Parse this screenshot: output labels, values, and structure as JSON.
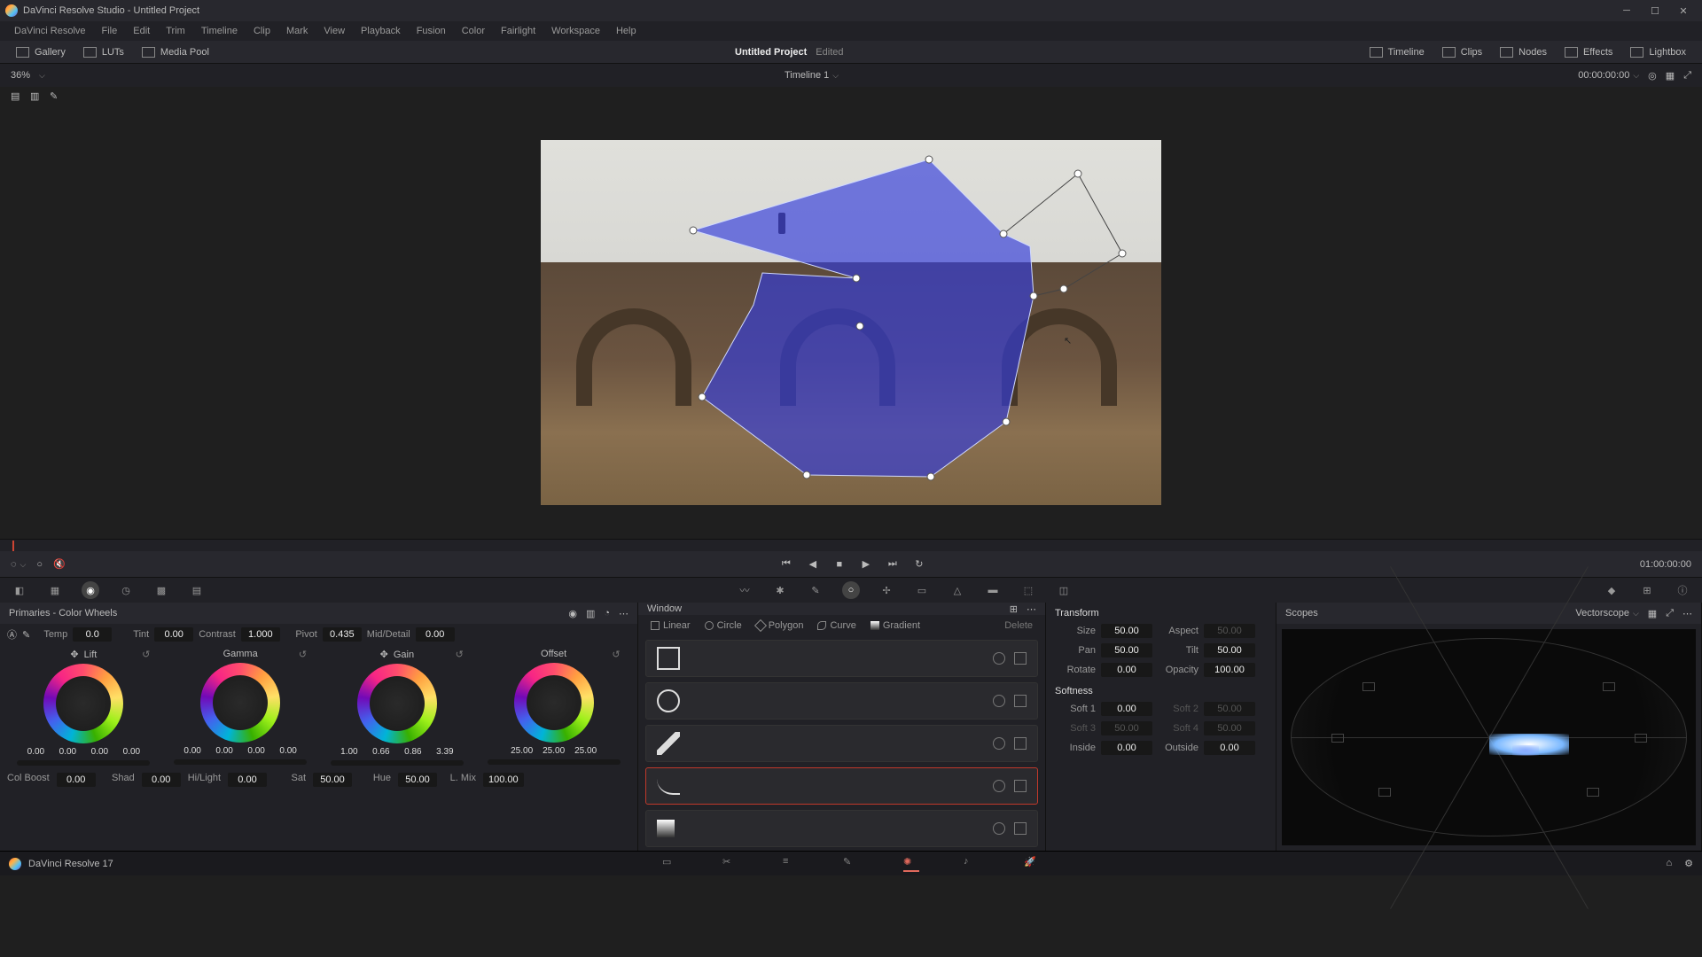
{
  "titlebar": {
    "title": "DaVinci Resolve Studio - Untitled Project"
  },
  "menus": [
    "DaVinci Resolve",
    "File",
    "Edit",
    "Trim",
    "Timeline",
    "Clip",
    "Mark",
    "View",
    "Playback",
    "Fusion",
    "Color",
    "Fairlight",
    "Workspace",
    "Help"
  ],
  "toolbar": {
    "gallery": "Gallery",
    "luts": "LUTs",
    "mediapool": "Media Pool",
    "project": "Untitled Project",
    "edited": "Edited",
    "timeline": "Timeline",
    "clips": "Clips",
    "nodes": "Nodes",
    "effects": "Effects",
    "lightbox": "Lightbox"
  },
  "zoom": {
    "pct": "36%",
    "timeline_name": "Timeline 1",
    "timecode": "00:00:00:00"
  },
  "playback": {
    "right_tc": "01:00:00:00"
  },
  "primaries": {
    "title": "Primaries - Color Wheels",
    "temp_l": "Temp",
    "temp_v": "0.0",
    "tint_l": "Tint",
    "tint_v": "0.00",
    "contrast_l": "Contrast",
    "contrast_v": "1.000",
    "pivot_l": "Pivot",
    "pivot_v": "0.435",
    "md_l": "Mid/Detail",
    "md_v": "0.00",
    "wheels": {
      "lift": {
        "name": "Lift",
        "vals": [
          "0.00",
          "0.00",
          "0.00",
          "0.00"
        ]
      },
      "gamma": {
        "name": "Gamma",
        "vals": [
          "0.00",
          "0.00",
          "0.00",
          "0.00"
        ]
      },
      "gain": {
        "name": "Gain",
        "vals": [
          "1.00",
          "0.66",
          "0.86",
          "3.39"
        ]
      },
      "offset": {
        "name": "Offset",
        "vals": [
          "25.00",
          "25.00",
          "25.00"
        ]
      }
    },
    "bottom": {
      "colboost_l": "Col Boost",
      "colboost_v": "0.00",
      "shad_l": "Shad",
      "shad_v": "0.00",
      "hilight_l": "Hi/Light",
      "hilight_v": "0.00",
      "sat_l": "Sat",
      "sat_v": "50.00",
      "hue_l": "Hue",
      "hue_v": "50.00",
      "lmix_l": "L. Mix",
      "lmix_v": "100.00"
    }
  },
  "window": {
    "title": "Window",
    "types": {
      "linear": "Linear",
      "circle": "Circle",
      "polygon": "Polygon",
      "curve": "Curve",
      "gradient": "Gradient",
      "delete": "Delete"
    }
  },
  "transform": {
    "title": "Transform",
    "size_l": "Size",
    "size_v": "50.00",
    "aspect_l": "Aspect",
    "aspect_v": "50.00",
    "pan_l": "Pan",
    "pan_v": "50.00",
    "tilt_l": "Tilt",
    "tilt_v": "50.00",
    "rotate_l": "Rotate",
    "rotate_v": "0.00",
    "opacity_l": "Opacity",
    "opacity_v": "100.00",
    "soft_title": "Softness",
    "s1_l": "Soft 1",
    "s1_v": "0.00",
    "s2_l": "Soft 2",
    "s2_v": "50.00",
    "s3_l": "Soft 3",
    "s3_v": "50.00",
    "s4_l": "Soft 4",
    "s4_v": "50.00",
    "inside_l": "Inside",
    "inside_v": "0.00",
    "outside_l": "Outside",
    "outside_v": "0.00"
  },
  "scopes": {
    "title": "Scopes",
    "mode": "Vectorscope"
  },
  "status": {
    "app": "DaVinci Resolve 17"
  }
}
